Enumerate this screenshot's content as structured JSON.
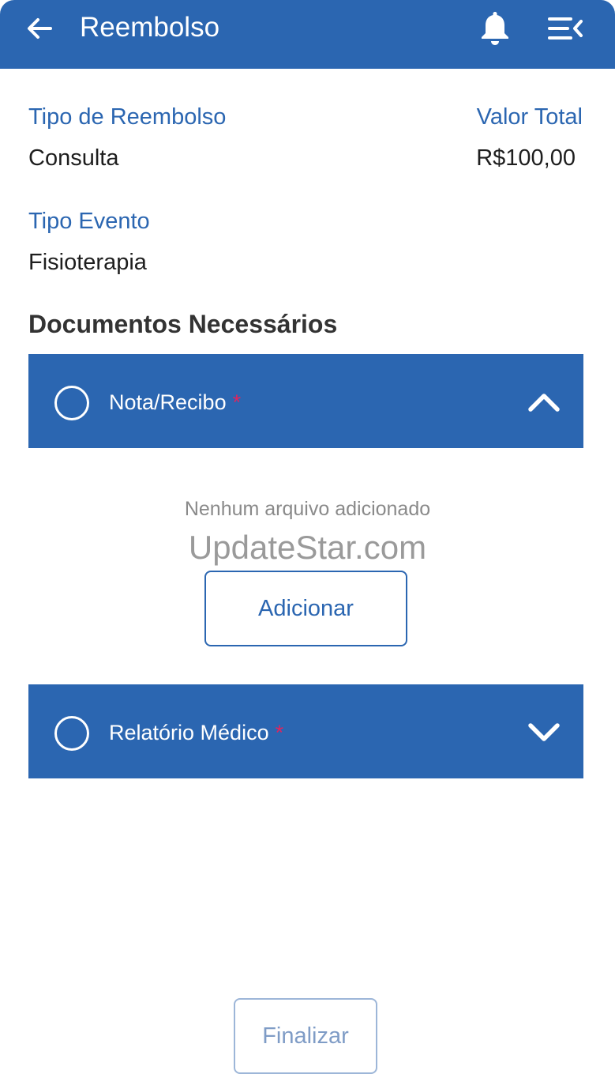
{
  "appbar": {
    "title": "Reembolso",
    "back_icon": "arrow-left-icon",
    "notification_icon": "bell-icon",
    "menu_icon": "menu-collapse-icon",
    "color": "#2b66b1"
  },
  "summary": {
    "tipo_reembolso_label": "Tipo de Reembolso",
    "tipo_reembolso_value": "Consulta",
    "valor_total_label": "Valor Total",
    "valor_total_value": "R$100,00",
    "tipo_evento_label": "Tipo Evento",
    "tipo_evento_value": "Fisioterapia"
  },
  "documents": {
    "title": "Documentos Necessários",
    "required_marker": "*",
    "items": [
      {
        "label": "Nota/Recibo",
        "expanded": true,
        "empty_text": "Nenhum arquivo adicionado",
        "add_label": "Adicionar"
      },
      {
        "label": "Relatório Médico",
        "expanded": false
      }
    ]
  },
  "watermark": "UpdateStar.com",
  "footer": {
    "finalize_label": "Finalizar"
  }
}
